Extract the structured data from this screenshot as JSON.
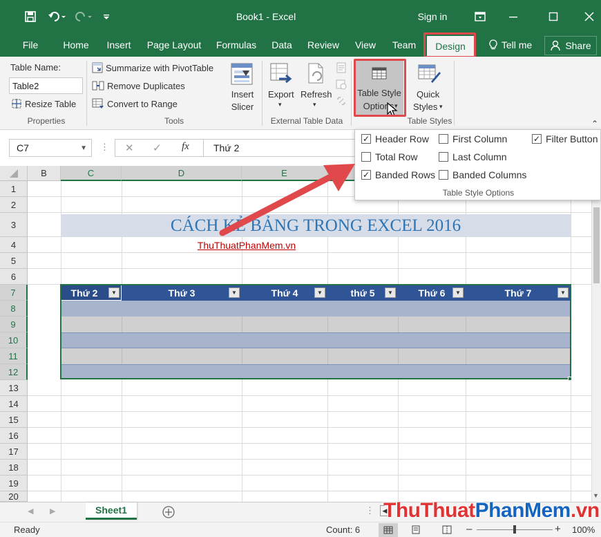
{
  "titlebar": {
    "title": "Book1  -  Excel",
    "signin": "Sign in",
    "accent": "#217346"
  },
  "menu": {
    "file": "File",
    "home": "Home",
    "insert": "Insert",
    "page_layout": "Page Layout",
    "formulas": "Formulas",
    "data": "Data",
    "review": "Review",
    "view": "View",
    "team": "Team",
    "design": "Design",
    "tell_me": "Tell me",
    "share": "Share"
  },
  "ribbon": {
    "properties": {
      "table_name_label": "Table Name:",
      "table_name_value": "Table2",
      "resize_table": "Resize Table",
      "group": "Properties"
    },
    "tools": {
      "summarize": "Summarize with PivotTable",
      "remove_duplicates": "Remove Duplicates",
      "convert_to_range": "Convert to Range",
      "insert_slicer_1": "Insert",
      "insert_slicer_2": "Slicer",
      "group": "Tools"
    },
    "external": {
      "export": "Export",
      "refresh": "Refresh",
      "group": "External Table Data"
    },
    "styles": {
      "tso_1": "Table Style",
      "tso_2": "Options",
      "quick_1": "Quick",
      "quick_2": "Styles",
      "group": "Table Styles"
    }
  },
  "formula_bar": {
    "name_box": "C7",
    "fx": "fx",
    "content": "Thứ 2"
  },
  "grid": {
    "columns": [
      "B",
      "C",
      "D",
      "E"
    ],
    "rows": [
      "1",
      "2",
      "3",
      "4",
      "5",
      "6",
      "7",
      "8",
      "9",
      "10",
      "11",
      "12",
      "13",
      "14",
      "15",
      "16",
      "17",
      "18",
      "19",
      "20"
    ],
    "banner": "CÁCH KẺ BẢNG TRONG EXCEL 2016",
    "sublink": "ThuThuatPhanMem.vn",
    "table_headers": [
      "Thứ 2",
      "Thứ 3",
      "Thứ 4",
      "thứ 5",
      "Thứ 6",
      "Thứ 7"
    ]
  },
  "table_style_options": {
    "options": [
      {
        "label": "Header Row",
        "checked": true
      },
      {
        "label": "First Column",
        "checked": false
      },
      {
        "label": "Filter Button",
        "checked": true
      },
      {
        "label": "Total Row",
        "checked": false
      },
      {
        "label": "Last Column",
        "checked": false
      },
      {
        "label": "Banded Rows",
        "checked": true
      },
      {
        "label": "Banded Columns",
        "checked": false
      }
    ],
    "caption": "Table Style Options"
  },
  "sheets": {
    "active": "Sheet1"
  },
  "status": {
    "ready": "Ready",
    "count": "Count: 6",
    "zoom": "100%"
  },
  "watermark": {
    "part1": "ThuThuat",
    "part2": "PhanMem",
    "part3": ".vn"
  },
  "colors": {
    "excel_green": "#217346",
    "table_header": "#2f5597",
    "band_dark": "#a8b4cb",
    "band_light": "#d0d0d0",
    "highlight_red": "#e0494b"
  }
}
